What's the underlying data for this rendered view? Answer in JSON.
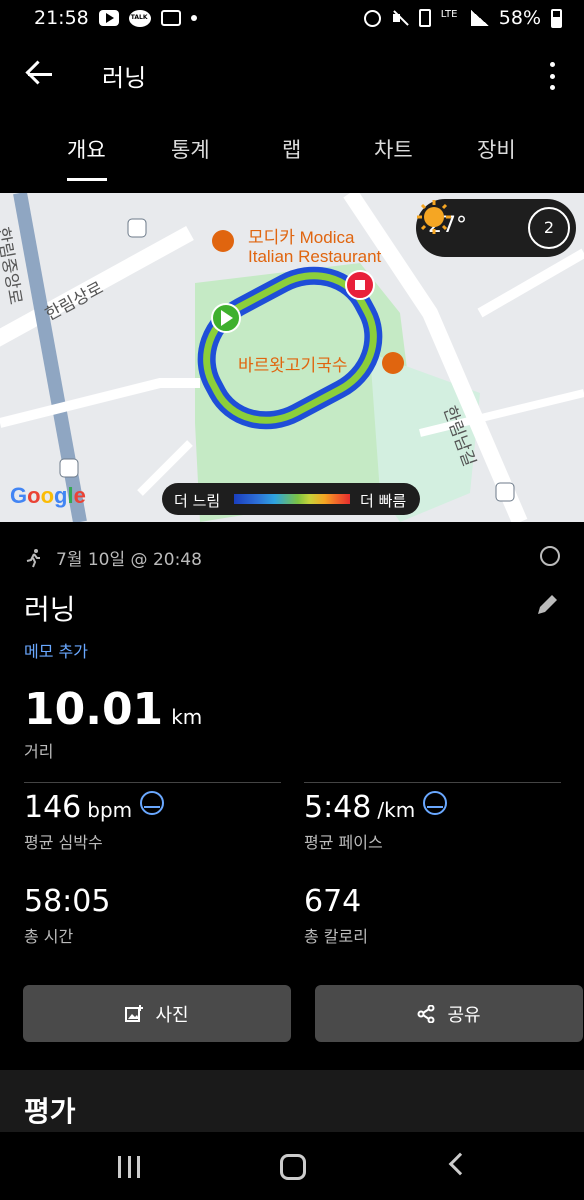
{
  "status_bar": {
    "time": "21:58",
    "battery": "58%",
    "network": "LTE",
    "icons": [
      "youtube-icon",
      "kakaotalk-icon",
      "voicemail-icon",
      "dot-icon",
      "alarm-icon",
      "mute-icon",
      "battery-saver-icon",
      "signal-icon",
      "battery-icon"
    ]
  },
  "app_bar": {
    "title": "러닝",
    "back_icon": "arrow-left-icon",
    "menu_icon": "more-vertical-icon"
  },
  "tabs": [
    {
      "label": "개요",
      "active": true
    },
    {
      "label": "통계",
      "active": false
    },
    {
      "label": "랩",
      "active": false
    },
    {
      "label": "차트",
      "active": false
    },
    {
      "label": "장비",
      "active": false
    }
  ],
  "map": {
    "places": {
      "restaurant_1_line1": "모디카 Modica",
      "restaurant_1_line2": "Italian Restaurant",
      "restaurant_2": "바르왓고기국수",
      "road_1": "한림상로",
      "road_2": "한림남길",
      "road_3": "한림중앙로"
    },
    "weather": {
      "temperature": "27°",
      "wind_level": "2",
      "condition_icon": "sun-icon"
    },
    "legend": {
      "slow": "더 느림",
      "fast": "더 빠름"
    },
    "attribution": "Google",
    "colors": {
      "start_marker": "#3fb02e",
      "end_marker": "#e8203a",
      "park": "#c5eac5",
      "route_outer": "#1f4ed8",
      "route_inner": "#8ccf3a"
    }
  },
  "summary": {
    "date": "7월 10일 @ 20:48",
    "title": "러닝",
    "add_memo": "메모 추가",
    "distance_value": "10.01",
    "distance_unit": "km",
    "distance_label": "거리",
    "heart_rate_value": "146",
    "heart_rate_unit": "bpm",
    "heart_rate_label": "평균 심박수",
    "pace_value": "5:48",
    "pace_unit": "/km",
    "pace_label": "평균 페이스",
    "time_value": "58:05",
    "time_label": "총 시간",
    "calories_value": "674",
    "calories_label": "총 칼로리"
  },
  "actions": {
    "photo": "사진",
    "share": "공유"
  },
  "section": {
    "rating_heading": "평가"
  },
  "colors": {
    "accent_blue": "#6aa8ff",
    "button_bg": "#4a4a4a",
    "background": "#000000"
  }
}
